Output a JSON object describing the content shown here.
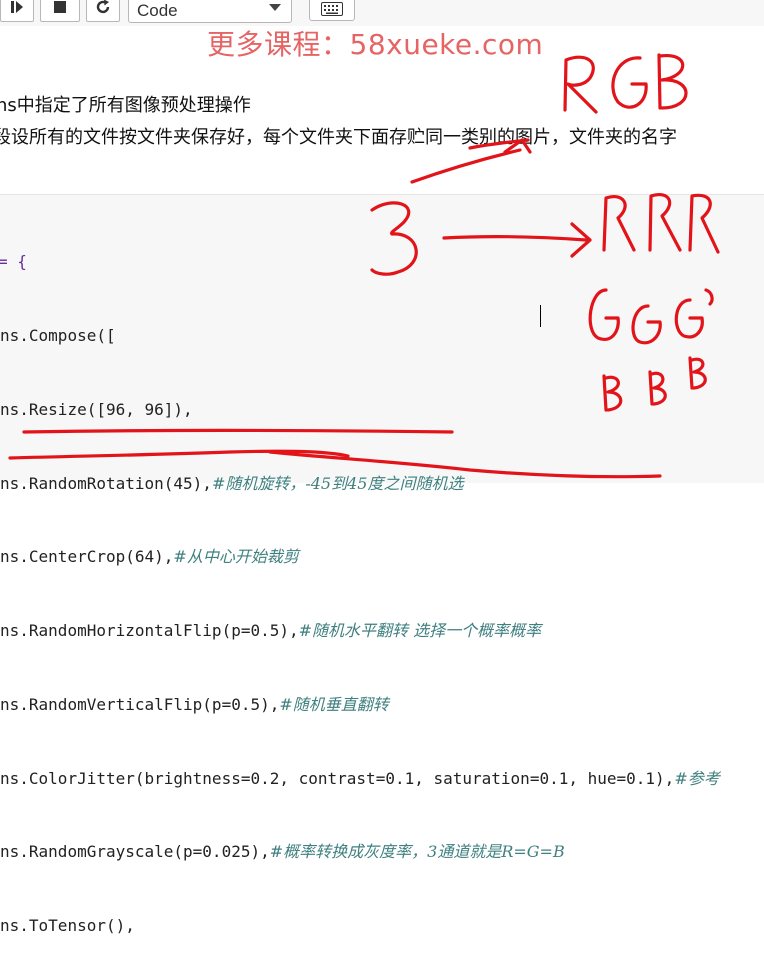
{
  "toolbar": {
    "cell_type_selected": "Code"
  },
  "watermark": "更多课程：58xueke.com",
  "markdown": {
    "line1": "ns中指定了所有图像预处理操作",
    "line2": "段设所有的文件按文件夹保存好，每个文件夹下面存贮同一类别的图片，文件夹的名字"
  },
  "code": {
    "open": "= {",
    "lines": [
      {
        "prefix": "ns.",
        "call": "Compose([",
        "comment": ""
      },
      {
        "prefix": "ns.",
        "call": "Resize([96, 96]),",
        "comment": ""
      },
      {
        "prefix": "ns.",
        "call": "RandomRotation(45),",
        "comment": "#随机旋转，-45到45度之间随机选"
      },
      {
        "prefix": "ns.",
        "call": "CenterCrop(64),",
        "comment": "#从中心开始裁剪"
      },
      {
        "prefix": "ns.",
        "call": "RandomHorizontalFlip(p=0.5),",
        "comment": "#随机水平翻转 选择一个概率概率"
      },
      {
        "prefix": "ns.",
        "call": "RandomVerticalFlip(p=0.5),",
        "comment": "#随机垂直翻转"
      },
      {
        "prefix": "ns.",
        "call": "ColorJitter(brightness=0.2, contrast=0.1, saturation=0.1, hue=0.1),",
        "comment": "#参考"
      },
      {
        "prefix": "ns.",
        "call": "RandomGrayscale(p=0.025),",
        "comment": "#概率转换成灰度率，3通道就是R=G=B"
      },
      {
        "prefix": "ns.",
        "call": "ToTensor(),",
        "comment": ""
      }
    ]
  },
  "handwriting": {
    "rgb": "RGB",
    "three": "3",
    "rrr": "RRR",
    "ggg": "GGG",
    "bbb": "BBB"
  },
  "colors": {
    "ink": "#e2141a",
    "comment": "#408080",
    "number": "#098658"
  }
}
